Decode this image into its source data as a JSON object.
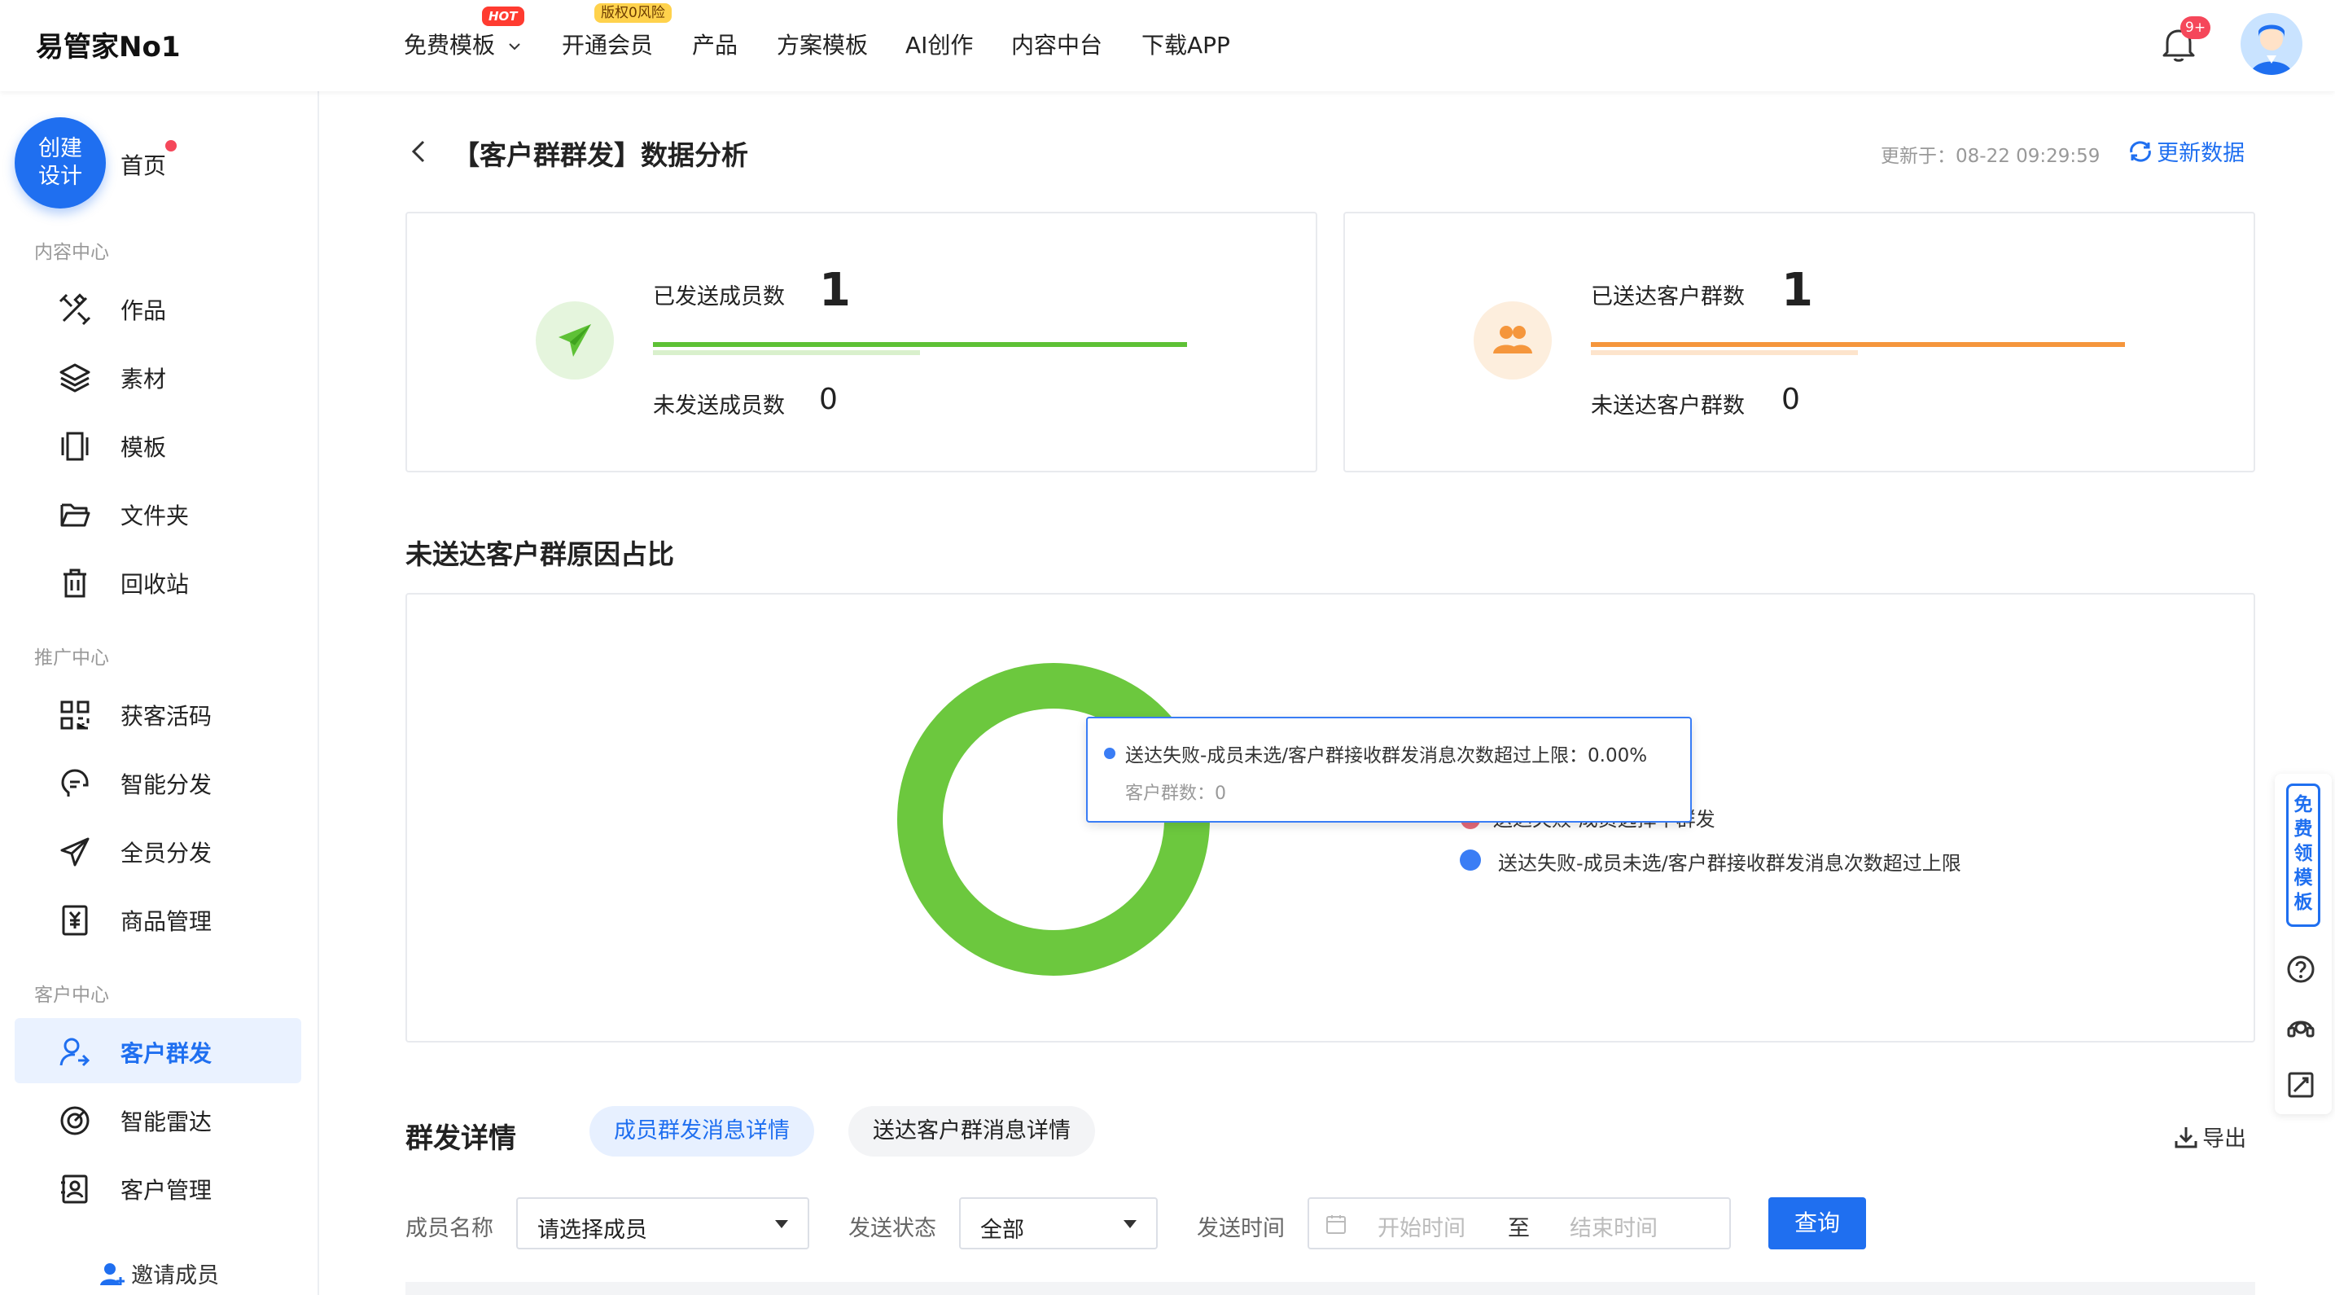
{
  "header": {
    "logo": "易管家No1",
    "nav": [
      {
        "label": "免费模板",
        "badge": "HOT",
        "has_dropdown": true
      },
      {
        "label": "开通会员",
        "badge": "版权0风险"
      },
      {
        "label": "产品"
      },
      {
        "label": "方案模板"
      },
      {
        "label": "AI创作"
      },
      {
        "label": "内容中台"
      },
      {
        "label": "下载APP"
      }
    ],
    "notification_count": "9+"
  },
  "sidebar": {
    "create_button": "创建\n设计",
    "home": "首页",
    "sections": [
      {
        "title": "内容中心",
        "items": [
          {
            "label": "作品",
            "icon": "works-icon"
          },
          {
            "label": "素材",
            "icon": "layers-icon"
          },
          {
            "label": "模板",
            "icon": "template-icon"
          },
          {
            "label": "文件夹",
            "icon": "folder-icon"
          },
          {
            "label": "回收站",
            "icon": "trash-icon"
          }
        ]
      },
      {
        "title": "推广中心",
        "items": [
          {
            "label": "获客活码",
            "icon": "qrcode-icon"
          },
          {
            "label": "智能分发",
            "icon": "smart-distribute-icon"
          },
          {
            "label": "全员分发",
            "icon": "send-icon"
          },
          {
            "label": "商品管理",
            "icon": "goods-icon"
          }
        ]
      },
      {
        "title": "客户中心",
        "items": [
          {
            "label": "客户群发",
            "icon": "customer-broadcast-icon",
            "active": true
          },
          {
            "label": "智能雷达",
            "icon": "radar-icon"
          },
          {
            "label": "客户管理",
            "icon": "customer-manage-icon"
          }
        ]
      }
    ],
    "invite": "邀请成员"
  },
  "page": {
    "title": "【客户群群发】数据分析",
    "updated_label": "更新于：08-22 09:29:59",
    "refresh_label": "更新数据"
  },
  "stats": [
    {
      "primary_label": "已发送成员数",
      "primary_value": "1",
      "secondary_label": "未发送成员数",
      "secondary_value": "0",
      "color": "#5ec136",
      "light": "#d9f0cc",
      "icon": "paper-plane-icon",
      "progress": 1.0
    },
    {
      "primary_label": "已送达客户群数",
      "primary_value": "1",
      "secondary_label": "未送达客户群数",
      "secondary_value": "0",
      "color": "#f5963c",
      "light": "#fde4cc",
      "icon": "group-icon",
      "progress": 1.0
    }
  ],
  "reason_section": {
    "title": "未送达客户群原因占比"
  },
  "chart_data": {
    "type": "pie",
    "donut": true,
    "slices": [
      {
        "label": "送达失败-成员未选/客户群接收群发消息次数超过上限",
        "value": 0,
        "color": "#3a7df5"
      }
    ],
    "background_ring_color": "#6cc83e",
    "legend_partial": "送达失败-成员选择不群发",
    "legend_partial_color": "#e56a7a",
    "tooltip": {
      "title": "送达失败-成员未选/客户群接收群发消息次数超过上限：0.00%",
      "sub": "客户群数：0"
    }
  },
  "detail": {
    "title": "群发详情",
    "tabs": [
      {
        "label": "成员群发消息详情",
        "active": true
      },
      {
        "label": "送达客户群消息详情",
        "active": false
      }
    ],
    "export_label": "导出",
    "filters": {
      "member_label": "成员名称",
      "member_placeholder": "请选择成员",
      "status_label": "发送状态",
      "status_value": "全部",
      "time_label": "发送时间",
      "start_placeholder": "开始时间",
      "to": "至",
      "end_placeholder": "结束时间",
      "query_button": "查询"
    }
  },
  "float_panel": {
    "free_template": "免费领模板"
  }
}
